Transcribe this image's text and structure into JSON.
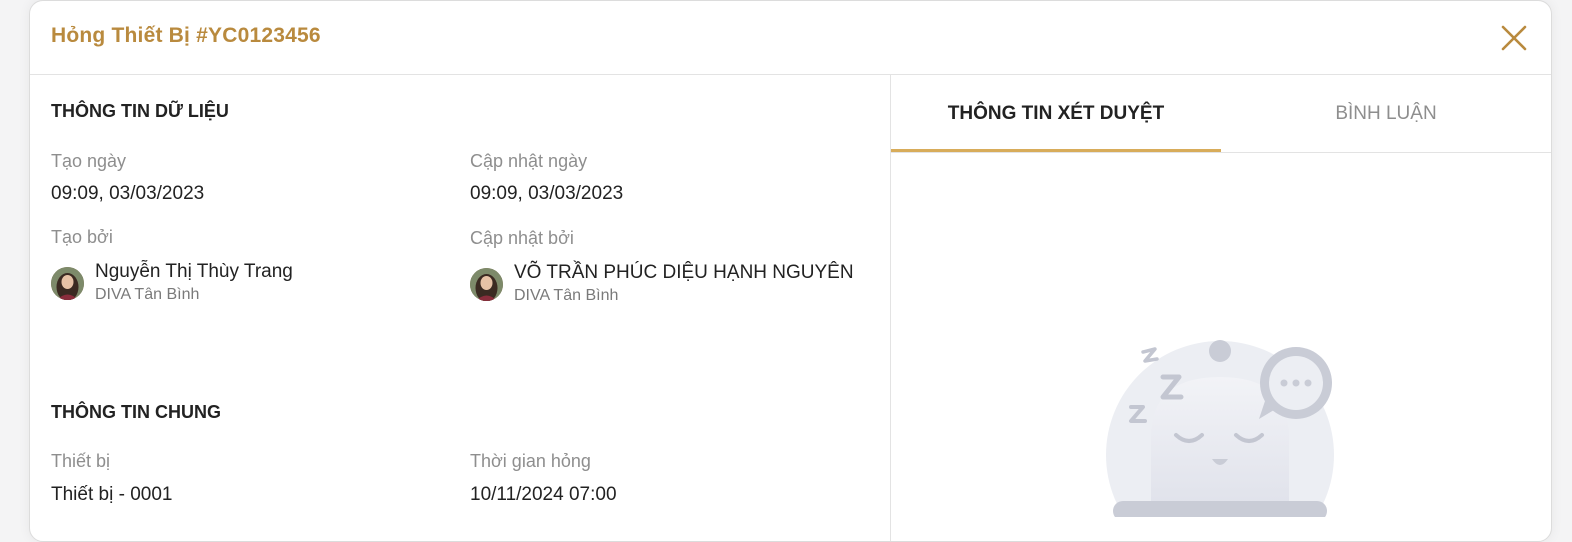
{
  "modal": {
    "title": "Hỏng Thiết Bị #YC0123456"
  },
  "data_info": {
    "section_title": "THÔNG TIN DỮ LIỆU",
    "created_date_label": "Tạo ngày",
    "created_date_value": "09:09, 03/03/2023",
    "updated_date_label": "Cập nhật ngày",
    "updated_date_value": "09:09, 03/03/2023",
    "created_by_label": "Tạo bởi",
    "created_by": {
      "name": "Nguyễn Thị Thùy Trang",
      "branch": "DIVA Tân Bình"
    },
    "updated_by_label": "Cập nhật bởi",
    "updated_by": {
      "name": "VÕ TRẦN PHÚC DIỆU HẠNH NGUYÊN",
      "branch": "DIVA Tân Bình"
    }
  },
  "general_info": {
    "section_title": "THÔNG TIN CHUNG",
    "device_label": "Thiết bị",
    "device_value": "Thiết bị - 0001",
    "failure_time_label": "Thời gian hỏng",
    "failure_time_value": "10/11/2024 07:00"
  },
  "tabs": [
    {
      "label": "THÔNG TIN XÉT DUYỆT",
      "active": true
    },
    {
      "label": "BÌNH LUẬN",
      "active": false
    }
  ],
  "colors": {
    "accent": "#b98a3e",
    "tab_underline": "#d8ac5a"
  },
  "icons": {
    "close": "close-icon",
    "empty_state": "sleeping-bell-illustration"
  }
}
